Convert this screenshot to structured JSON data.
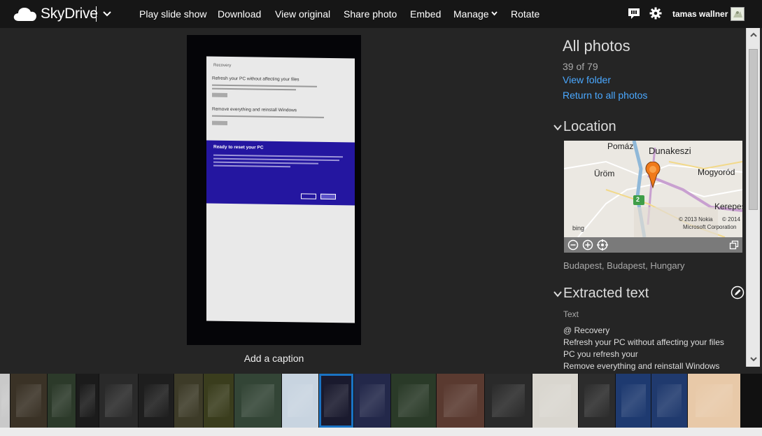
{
  "app": {
    "brand": "SkyDrive"
  },
  "toolbar": {
    "items": [
      "Play slide show",
      "Download",
      "View original",
      "Share photo",
      "Embed",
      "Manage",
      "Rotate"
    ]
  },
  "user": {
    "name": "tamas wallner"
  },
  "photo": {
    "screen_heading": "Recovery",
    "section1": "Refresh your PC without affecting your files",
    "section2": "Remove everything and reinstall Windows",
    "dialog_title": "Ready to reset your PC",
    "caption_prompt": "Add a caption"
  },
  "panel": {
    "title": "All photos",
    "count": "39 of 79",
    "view_folder": "View folder",
    "return_link": "Return to all photos",
    "location": {
      "heading": "Location",
      "map_labels": [
        "Pomáz",
        "Dunakeszi",
        "Üröm",
        "Mogyoród",
        "Kerepes"
      ],
      "map_copyright_1": "© 2013 Nokia",
      "map_copyright_2": "© 2014",
      "map_copyright_3": "Microsoft Corporation",
      "map_brand": "bing",
      "route_badge": "2",
      "place": "Budapest, Budapest, Hungary"
    },
    "extracted": {
      "heading": "Extracted text",
      "label": "Text",
      "lines": [
        "@ Recovery",
        "Refresh your PC without affecting your files",
        "PC you refresh your",
        "Remove everything and reinstall Windows"
      ]
    }
  },
  "filmstrip": {
    "selected_index": 10,
    "thumbs": [
      {
        "color": "#c9c9c9"
      },
      {
        "color": "#3a3226"
      },
      {
        "color": "#2c3a2a"
      },
      {
        "color": "#1b1b1b"
      },
      {
        "color": "#2a2a2a"
      },
      {
        "color": "#1e1e1e"
      },
      {
        "color": "#3d3b28"
      },
      {
        "color": "#3a3d1d"
      },
      {
        "color": "#334536"
      },
      {
        "color": "#c8d4e0"
      },
      {
        "color": "#1a1a2e"
      },
      {
        "color": "#23284a"
      },
      {
        "color": "#2a3a28"
      },
      {
        "color": "#5a3a30"
      },
      {
        "color": "#2a2a2a"
      },
      {
        "color": "#d9d6cf"
      },
      {
        "color": "#2c2c2c"
      },
      {
        "color": "#1e3a70"
      },
      {
        "color": "#203a6e"
      },
      {
        "color": "#e8c9a8"
      }
    ]
  },
  "colors": {
    "accent_link": "#4aa8ff",
    "topbar": "#161616",
    "background": "#252525",
    "selected_thumb": "#1a73c4"
  }
}
